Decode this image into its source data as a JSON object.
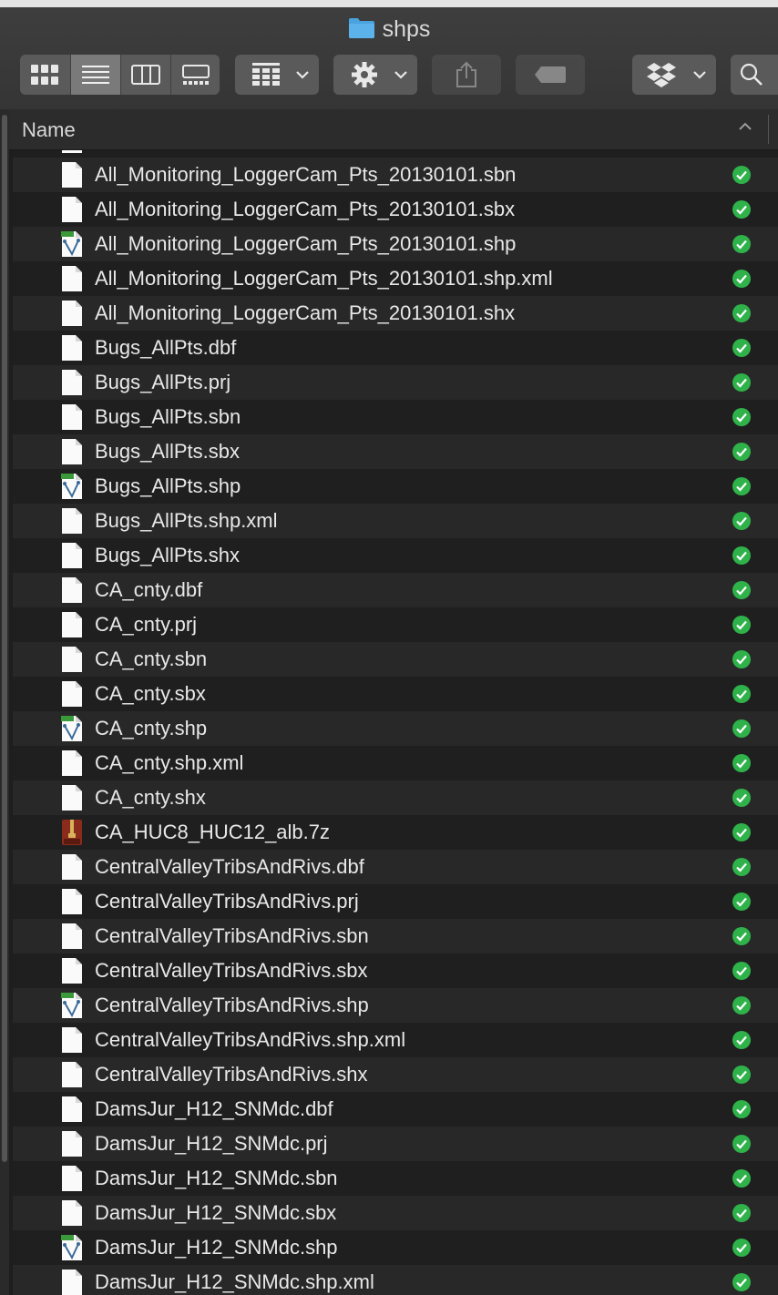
{
  "window": {
    "title": "shps",
    "accent": "#4aa3df"
  },
  "toolbar": {
    "view_modes": [
      "icon-view",
      "list-view",
      "column-view",
      "gallery-view"
    ],
    "active_view": "list-view",
    "group_icon": "group-icon",
    "action_icon": "gear-icon",
    "share_icon": "share-icon",
    "tag_icon": "tag-icon",
    "dropbox_icon": "dropbox-icon",
    "search_icon": "search-icon"
  },
  "list_header": {
    "name_label": "Name",
    "sort_icon": "chevron-up-icon"
  },
  "status_color": "#2fb24a",
  "files": [
    {
      "name": "All_Monitoring_LoggerCam_Pts_20130101.sbn",
      "kind": "doc"
    },
    {
      "name": "All_Monitoring_LoggerCam_Pts_20130101.sbx",
      "kind": "doc"
    },
    {
      "name": "All_Monitoring_LoggerCam_Pts_20130101.shp",
      "kind": "shp"
    },
    {
      "name": "All_Monitoring_LoggerCam_Pts_20130101.shp.xml",
      "kind": "doc"
    },
    {
      "name": "All_Monitoring_LoggerCam_Pts_20130101.shx",
      "kind": "doc"
    },
    {
      "name": "Bugs_AllPts.dbf",
      "kind": "doc"
    },
    {
      "name": "Bugs_AllPts.prj",
      "kind": "doc"
    },
    {
      "name": "Bugs_AllPts.sbn",
      "kind": "doc"
    },
    {
      "name": "Bugs_AllPts.sbx",
      "kind": "doc"
    },
    {
      "name": "Bugs_AllPts.shp",
      "kind": "shp"
    },
    {
      "name": "Bugs_AllPts.shp.xml",
      "kind": "doc"
    },
    {
      "name": "Bugs_AllPts.shx",
      "kind": "doc"
    },
    {
      "name": "CA_cnty.dbf",
      "kind": "doc"
    },
    {
      "name": "CA_cnty.prj",
      "kind": "doc"
    },
    {
      "name": "CA_cnty.sbn",
      "kind": "doc"
    },
    {
      "name": "CA_cnty.sbx",
      "kind": "doc"
    },
    {
      "name": "CA_cnty.shp",
      "kind": "shp"
    },
    {
      "name": "CA_cnty.shp.xml",
      "kind": "doc"
    },
    {
      "name": "CA_cnty.shx",
      "kind": "doc"
    },
    {
      "name": "CA_HUC8_HUC12_alb.7z",
      "kind": "7z"
    },
    {
      "name": "CentralValleyTribsAndRivs.dbf",
      "kind": "doc"
    },
    {
      "name": "CentralValleyTribsAndRivs.prj",
      "kind": "doc"
    },
    {
      "name": "CentralValleyTribsAndRivs.sbn",
      "kind": "doc"
    },
    {
      "name": "CentralValleyTribsAndRivs.sbx",
      "kind": "doc"
    },
    {
      "name": "CentralValleyTribsAndRivs.shp",
      "kind": "shp"
    },
    {
      "name": "CentralValleyTribsAndRivs.shp.xml",
      "kind": "doc"
    },
    {
      "name": "CentralValleyTribsAndRivs.shx",
      "kind": "doc"
    },
    {
      "name": "DamsJur_H12_SNMdc.dbf",
      "kind": "doc"
    },
    {
      "name": "DamsJur_H12_SNMdc.prj",
      "kind": "doc"
    },
    {
      "name": "DamsJur_H12_SNMdc.sbn",
      "kind": "doc"
    },
    {
      "name": "DamsJur_H12_SNMdc.sbx",
      "kind": "doc"
    },
    {
      "name": "DamsJur_H12_SNMdc.shp",
      "kind": "shp"
    },
    {
      "name": "DamsJur_H12_SNMdc.shp.xml",
      "kind": "doc"
    }
  ]
}
